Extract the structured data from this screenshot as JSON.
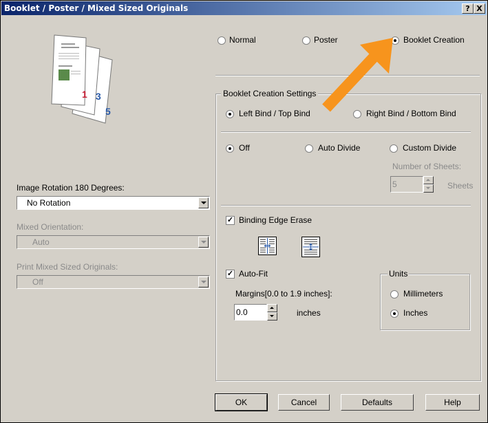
{
  "window": {
    "title": "Booklet / Poster / Mixed Sized Originals",
    "help_btn": "?",
    "close_btn": "X"
  },
  "mode": {
    "normal": "Normal",
    "poster": "Poster",
    "booklet": "Booklet Creation",
    "selected": "booklet"
  },
  "booklet_settings": {
    "group_label": "Booklet Creation Settings",
    "left_bind": "Left Bind / Top Bind",
    "right_bind": "Right Bind / Bottom Bind",
    "bind_selected": "left",
    "off": "Off",
    "auto_divide": "Auto Divide",
    "custom_divide": "Custom Divide",
    "divide_selected": "off",
    "num_sheets_label": "Number of Sheets:",
    "num_sheets_value": "5",
    "sheets_unit": "Sheets",
    "binding_edge_erase": "Binding Edge Erase",
    "binding_edge_erase_checked": true,
    "auto_fit": "Auto-Fit",
    "auto_fit_checked": true,
    "margins_label": "Margins[0.0 to 1.9 inches]:",
    "margins_value": "0.0",
    "margins_unit": "inches",
    "units_label": "Units",
    "millimeters": "Millimeters",
    "inches": "Inches",
    "units_selected": "inches"
  },
  "left_panel": {
    "image_rotation_label": "Image Rotation 180 Degrees:",
    "image_rotation_value": "No Rotation",
    "mixed_orientation_label": "Mixed Orientation:",
    "mixed_orientation_value": "Auto",
    "print_mixed_label": "Print Mixed Sized Originals:",
    "print_mixed_value": "Off",
    "preview_page_numbers": [
      "1",
      "3",
      "5"
    ]
  },
  "buttons": {
    "ok": "OK",
    "cancel": "Cancel",
    "defaults": "Defaults",
    "help": "Help"
  },
  "colors": {
    "arrow": "#f7941d",
    "title_start": "#0a246a",
    "title_end": "#a6caf0"
  }
}
